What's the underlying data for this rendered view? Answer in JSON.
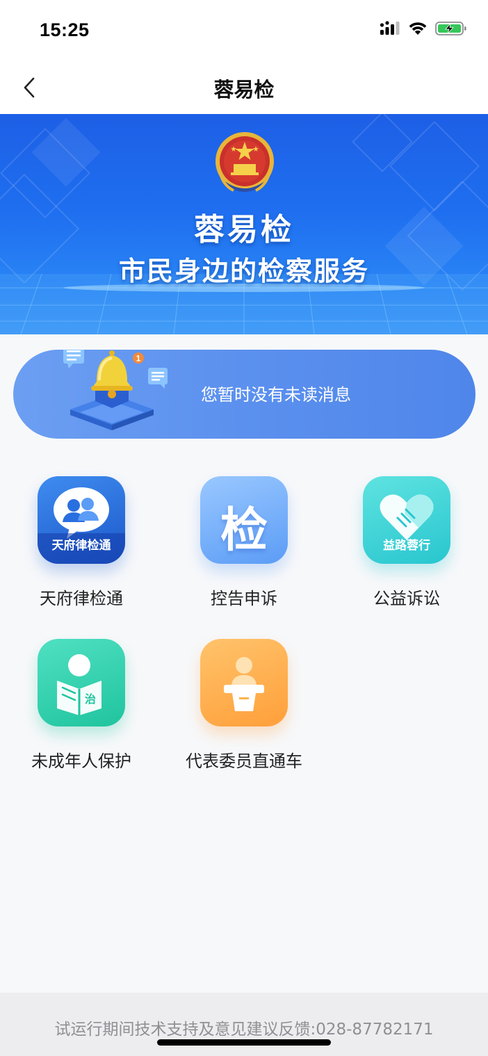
{
  "status_bar": {
    "time": "15:25"
  },
  "nav": {
    "title": "蓉易检"
  },
  "banner": {
    "title": "蓉易检",
    "subtitle": "市民身边的检察服务"
  },
  "notice": {
    "text": "您暂时没有未读消息",
    "badge": "1"
  },
  "services": [
    {
      "label": "天府律检通",
      "icon": "people-chat-icon",
      "icon_caption": "天府律检通",
      "color": "#2a6fe0"
    },
    {
      "label": "控告申诉",
      "icon": "jian-character-icon",
      "icon_glyph": "检",
      "color": "#6aa8f8"
    },
    {
      "label": "公益诉讼",
      "icon": "heart-handshake-icon",
      "icon_caption": "益路蓉行",
      "color": "#2fcad3"
    },
    {
      "label": "未成年人保护",
      "icon": "child-book-icon",
      "icon_glyph": "治",
      "color": "#25c9a3"
    },
    {
      "label": "代表委员直通车",
      "icon": "podium-speaker-icon",
      "color": "#ffa746"
    }
  ],
  "footer": {
    "text": "试运行期间技术支持及意见建议反馈:028-87782171"
  }
}
